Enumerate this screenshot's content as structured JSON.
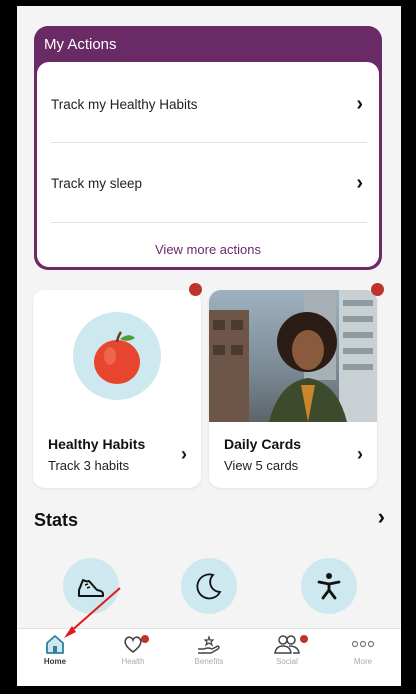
{
  "my_actions": {
    "title": "My Actions",
    "items": [
      {
        "label": "Track my Healthy Habits"
      },
      {
        "label": "Track my sleep"
      }
    ],
    "view_more": "View more actions"
  },
  "tiles": {
    "habits": {
      "title": "Healthy Habits",
      "subtitle": "Track 3 habits",
      "icon": "apple-icon"
    },
    "cards": {
      "title": "Daily Cards",
      "subtitle": "View 5 cards",
      "image": "woman-photo"
    }
  },
  "stats": {
    "title": "Stats",
    "items": [
      {
        "icon": "shoe-icon"
      },
      {
        "icon": "moon-icon"
      },
      {
        "icon": "activity-person-icon"
      }
    ]
  },
  "nav": {
    "items": [
      {
        "label": "Home",
        "icon": "home-icon",
        "active": true
      },
      {
        "label": "Health",
        "icon": "heart-icon",
        "badge": true
      },
      {
        "label": "Benefits",
        "icon": "benefits-hand-icon"
      },
      {
        "label": "Social",
        "icon": "people-icon",
        "badge": true
      },
      {
        "label": "More",
        "icon": "more-dots-icon"
      }
    ]
  },
  "colors": {
    "brand_purple": "#6a2a66",
    "badge_red": "#c0332b",
    "icon_circle": "#cde9ef",
    "nav_active": "#2f7fa0",
    "annotation_arrow": "#e01b1b"
  }
}
